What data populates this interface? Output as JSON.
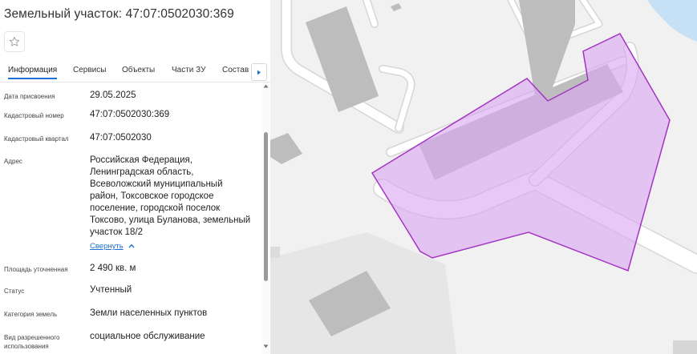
{
  "panel": {
    "title": "Земельный участок: 47:07:0502030:369",
    "tabs": [
      {
        "label": "Информация",
        "active": true
      },
      {
        "label": "Сервисы",
        "active": false
      },
      {
        "label": "Объекты",
        "active": false
      },
      {
        "label": "Части ЗУ",
        "active": false
      },
      {
        "label": "Состав",
        "active": false
      }
    ],
    "fields": {
      "assign_date": {
        "label": "Дата присвоения",
        "value": "29.05.2025"
      },
      "cad_number": {
        "label": "Кадастровый номер",
        "value": "47:07:0502030:369"
      },
      "cad_block": {
        "label": "Кадастровый квартал",
        "value": "47:07:0502030"
      },
      "address": {
        "label": "Адрес",
        "lines": [
          "Российская Федерация,",
          "Ленинградская область,",
          "Всеволожский муниципальный",
          "район, Токсовское городское",
          "поселение, городской поселок",
          "Токсово, улица Буланова, земельный",
          "участок 18/2"
        ],
        "collapse_label": "Свернуть"
      },
      "area": {
        "label": "Площадь уточненная",
        "value": "2 490 кв. м"
      },
      "status": {
        "label": "Статус",
        "value": "Учтенный"
      },
      "category": {
        "label": "Категория земель",
        "value": "Земли населенных пунктов"
      },
      "permitted_use": {
        "label_lines": [
          "Вид разрешенного",
          "использования"
        ],
        "value": "социальное обслуживание"
      }
    }
  },
  "icons": {
    "favorite": "star-outline-icon",
    "tab_scroll": "triangle-right-icon",
    "collapse": "chevron-up-icon",
    "scroll_up": "triangle-up-icon",
    "scroll_down": "triangle-down-icon"
  },
  "colors": {
    "accent": "#1d6fd0",
    "parcel_fill": "#d9a6f0",
    "parcel_stroke": "#a335c2"
  }
}
